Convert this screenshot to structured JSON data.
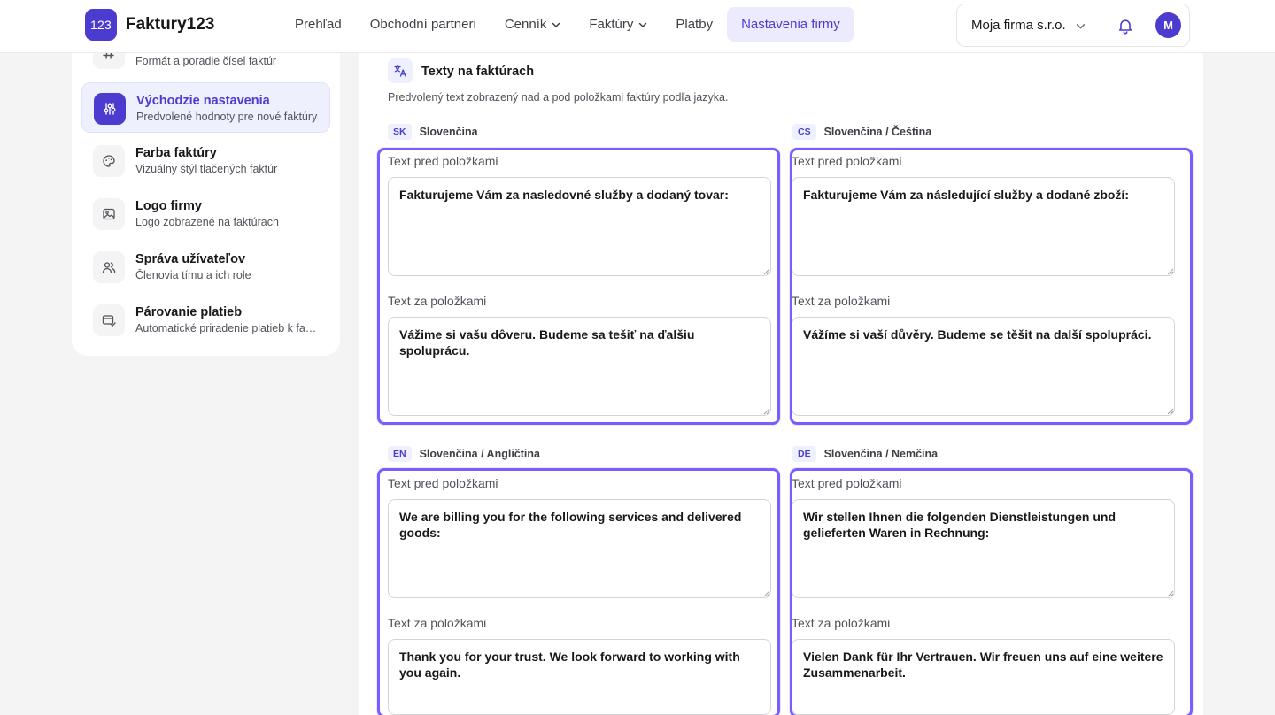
{
  "brand": {
    "logo_badge": "123",
    "name": "Faktury123",
    "accent": "#4c3bcf",
    "highlight": "#7c5cff"
  },
  "nav": {
    "items": [
      {
        "label": "Prehľad",
        "has_dropdown": false
      },
      {
        "label": "Obchodní partneri",
        "has_dropdown": false
      },
      {
        "label": "Cenník",
        "has_dropdown": true
      },
      {
        "label": "Faktúry",
        "has_dropdown": true
      },
      {
        "label": "Platby",
        "has_dropdown": false
      },
      {
        "label": "Nastavenia firmy",
        "has_dropdown": false,
        "active": true
      }
    ]
  },
  "header": {
    "company_name": "Moja firma s.r.o.",
    "notifications_icon": "bell-icon",
    "avatar_letter": "M"
  },
  "sidebar": {
    "items": [
      {
        "title": "",
        "subtitle": "Formát a poradie čísel faktúr",
        "icon": "hash-icon"
      },
      {
        "title": "Východzie nastavenia",
        "subtitle": "Predvolené hodnoty pre nové faktúry",
        "icon": "sliders-icon",
        "active": true
      },
      {
        "title": "Farba faktúry",
        "subtitle": "Vizuálny štýl tlačených faktúr",
        "icon": "palette-icon"
      },
      {
        "title": "Logo firmy",
        "subtitle": "Logo zobrazené na faktúrach",
        "icon": "image-icon"
      },
      {
        "title": "Správa užívateľov",
        "subtitle": "Členovia tímu a ich role",
        "icon": "users-icon"
      },
      {
        "title": "Párovanie platieb",
        "subtitle": "Automatické priradenie platieb k faktúram",
        "icon": "payment-match-icon"
      }
    ]
  },
  "section": {
    "title": "Texty na faktúrach",
    "description": "Predvolený text zobrazený nad a pod položkami faktúry podľa jazyka.",
    "icon": "translate-icon",
    "languages": [
      {
        "code": "SK",
        "name": "Slovenčina",
        "before_label": "Text pred položkami",
        "before_text": "Fakturujeme Vám za nasledovné služby a dodaný tovar:",
        "after_label": "Text za položkami",
        "after_text": "Vážime si vašu dôveru. Budeme sa tešiť na ďalšiu spoluprácu."
      },
      {
        "code": "CS",
        "name": "Slovenčina / Čeština",
        "before_label": "Text pred položkami",
        "before_text": "Fakturujeme Vám za následující služby a dodané zboží:",
        "after_label": "Text za položkami",
        "after_text": "Vážíme si vaší důvěry. Budeme se těšit na další spolupráci."
      },
      {
        "code": "EN",
        "name": "Slovenčina / Angličtina",
        "before_label": "Text pred položkami",
        "before_text": "We are billing you for the following services and delivered goods:",
        "after_label": "Text za položkami",
        "after_text": "Thank you for your trust. We look forward to working with you again."
      },
      {
        "code": "DE",
        "name": "Slovenčina / Nemčina",
        "before_label": "Text pred položkami",
        "before_text": "Wir stellen Ihnen die folgenden Dienstleistungen und gelieferten Waren in Rechnung:",
        "after_label": "Text za položkami",
        "after_text": "Vielen Dank für Ihr Vertrauen. Wir freuen uns auf eine weitere Zusammenarbeit."
      }
    ]
  }
}
